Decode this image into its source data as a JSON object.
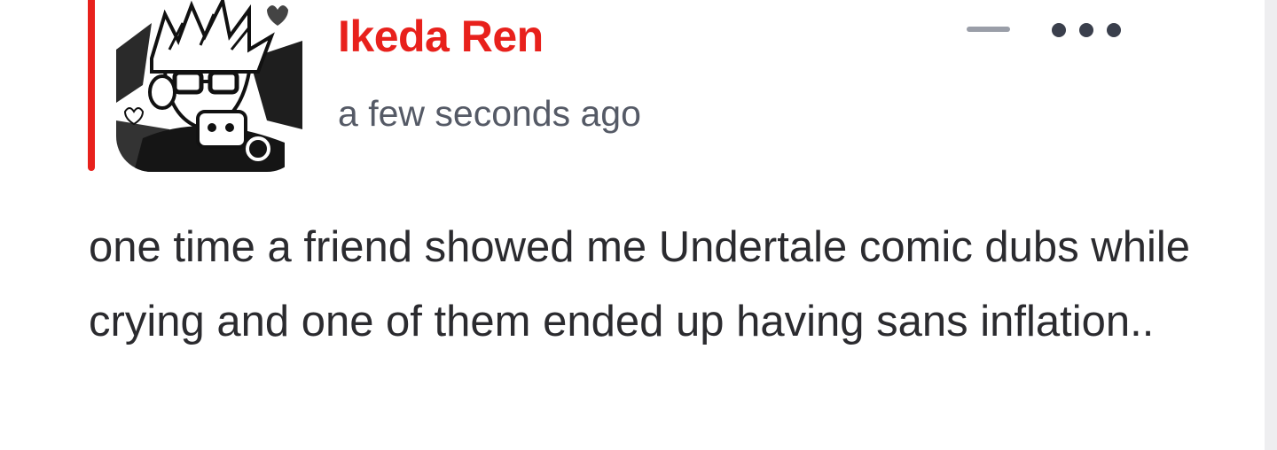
{
  "comment": {
    "author": "Ikeda Ren",
    "timestamp": "a few seconds ago",
    "body": "one time a friend showed me Undertale comic dubs while crying and one of them ended up having sans inflation..",
    "avatar_icon": "manga-character-avatar"
  },
  "actions": {
    "collapse_icon": "minus-icon",
    "more_icon": "ellipsis-icon"
  },
  "colors": {
    "accent": "#e8211c",
    "author": "#e8211c",
    "icon": "#9a9ea8",
    "icon_dark": "#3a3f4c",
    "text": "#2b2b2f",
    "meta": "#555a66"
  }
}
